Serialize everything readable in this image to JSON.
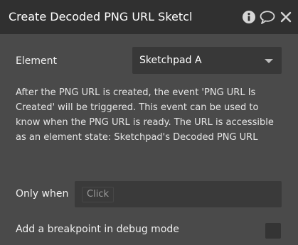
{
  "header": {
    "title": "Create Decoded PNG URL Sketcl",
    "icons": [
      "info-icon",
      "comment-icon",
      "close-icon"
    ]
  },
  "element_field": {
    "label": "Element",
    "value": "Sketchpad A"
  },
  "help_text": "After the PNG URL is created, the event 'PNG URL Is Created' will be triggered. This event can be used to know when the PNG URL is ready. The URL is accessible as an element state: Sketchpad's Decoded PNG URL",
  "only_when": {
    "label": "Only when",
    "placeholder": "Click"
  },
  "breakpoint": {
    "label": "Add a breakpoint in debug mode",
    "checked": false
  },
  "colors": {
    "panel_bg": "#4a4a4a",
    "header_bg": "#303030",
    "input_bg": "#383838"
  }
}
